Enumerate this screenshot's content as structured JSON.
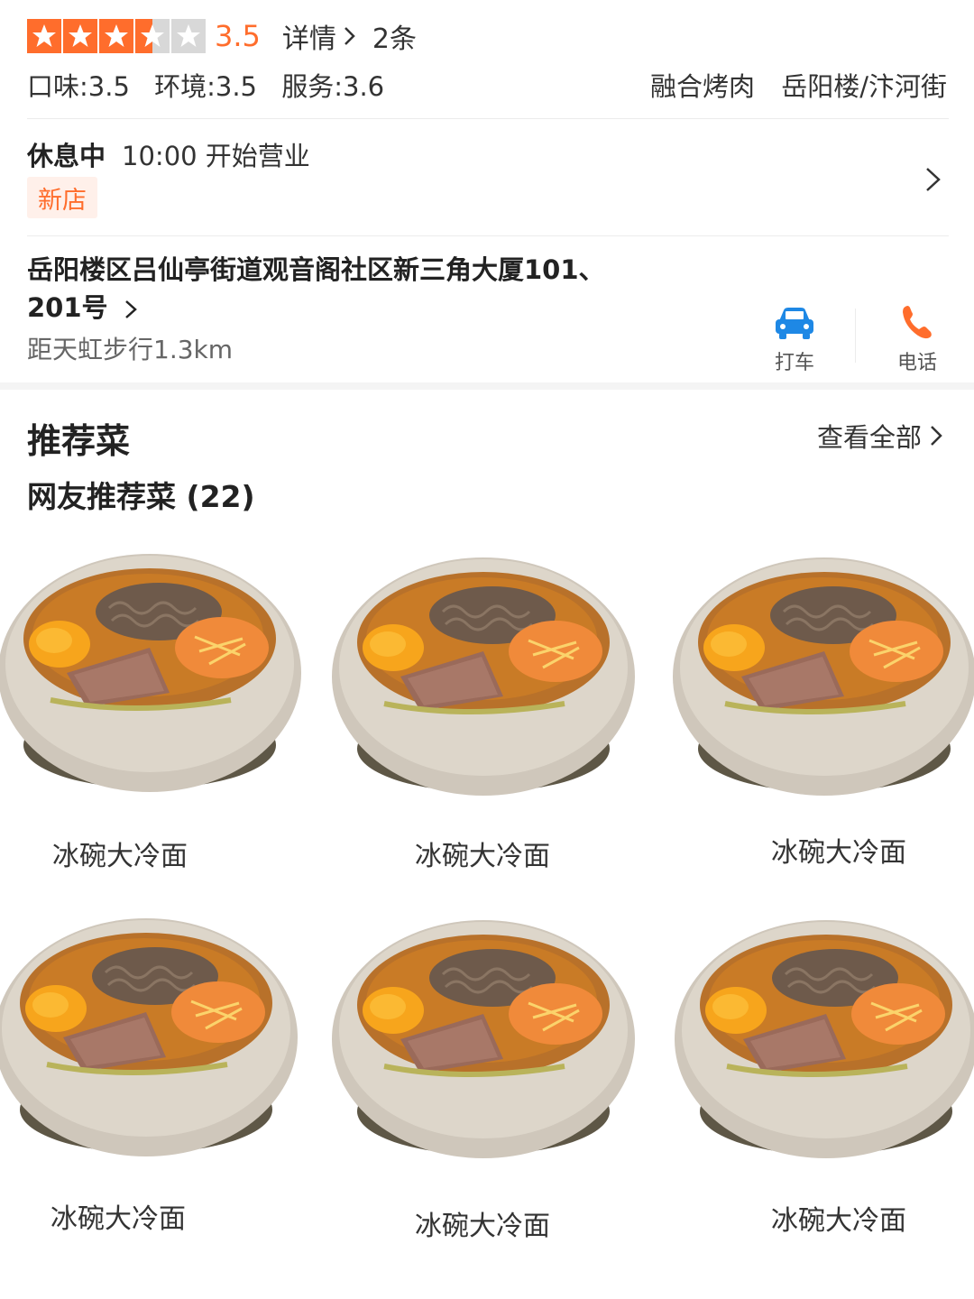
{
  "rating": {
    "score": "3.5",
    "stars_filled": 3.5,
    "stars_total": 5,
    "detail_label": "详情",
    "review_count": "2条"
  },
  "sub_ratings": {
    "taste": "口味:3.5",
    "environment": "环境:3.5",
    "service": "服务:3.6"
  },
  "tags": {
    "category": "融合烤肉",
    "area": "岳阳楼/汴河街"
  },
  "hours": {
    "status": "休息中",
    "open_time": "10:00 开始营业",
    "badge": "新店"
  },
  "address": {
    "line1": "岳阳楼区吕仙亭街道观音阁社区新三角大厦101、",
    "line2": "201号",
    "distance": "距天虹步行1.3km"
  },
  "actions": {
    "taxi": "打车",
    "phone": "电话"
  },
  "recommended": {
    "title": "推荐菜",
    "view_all": "查看全部",
    "subtitle": "网友推荐菜 (22)",
    "dishes": [
      {
        "name": "冰碗大冷面"
      },
      {
        "name": "冰碗大冷面"
      },
      {
        "name": "冰碗大冷面"
      },
      {
        "name": "冰碗大冷面"
      },
      {
        "name": "冰碗大冷面"
      },
      {
        "name": "冰碗大冷面"
      }
    ]
  },
  "colors": {
    "accent": "#ff6d2c",
    "taxi_icon": "#1e88e5",
    "star_empty": "#d8d8d8"
  }
}
